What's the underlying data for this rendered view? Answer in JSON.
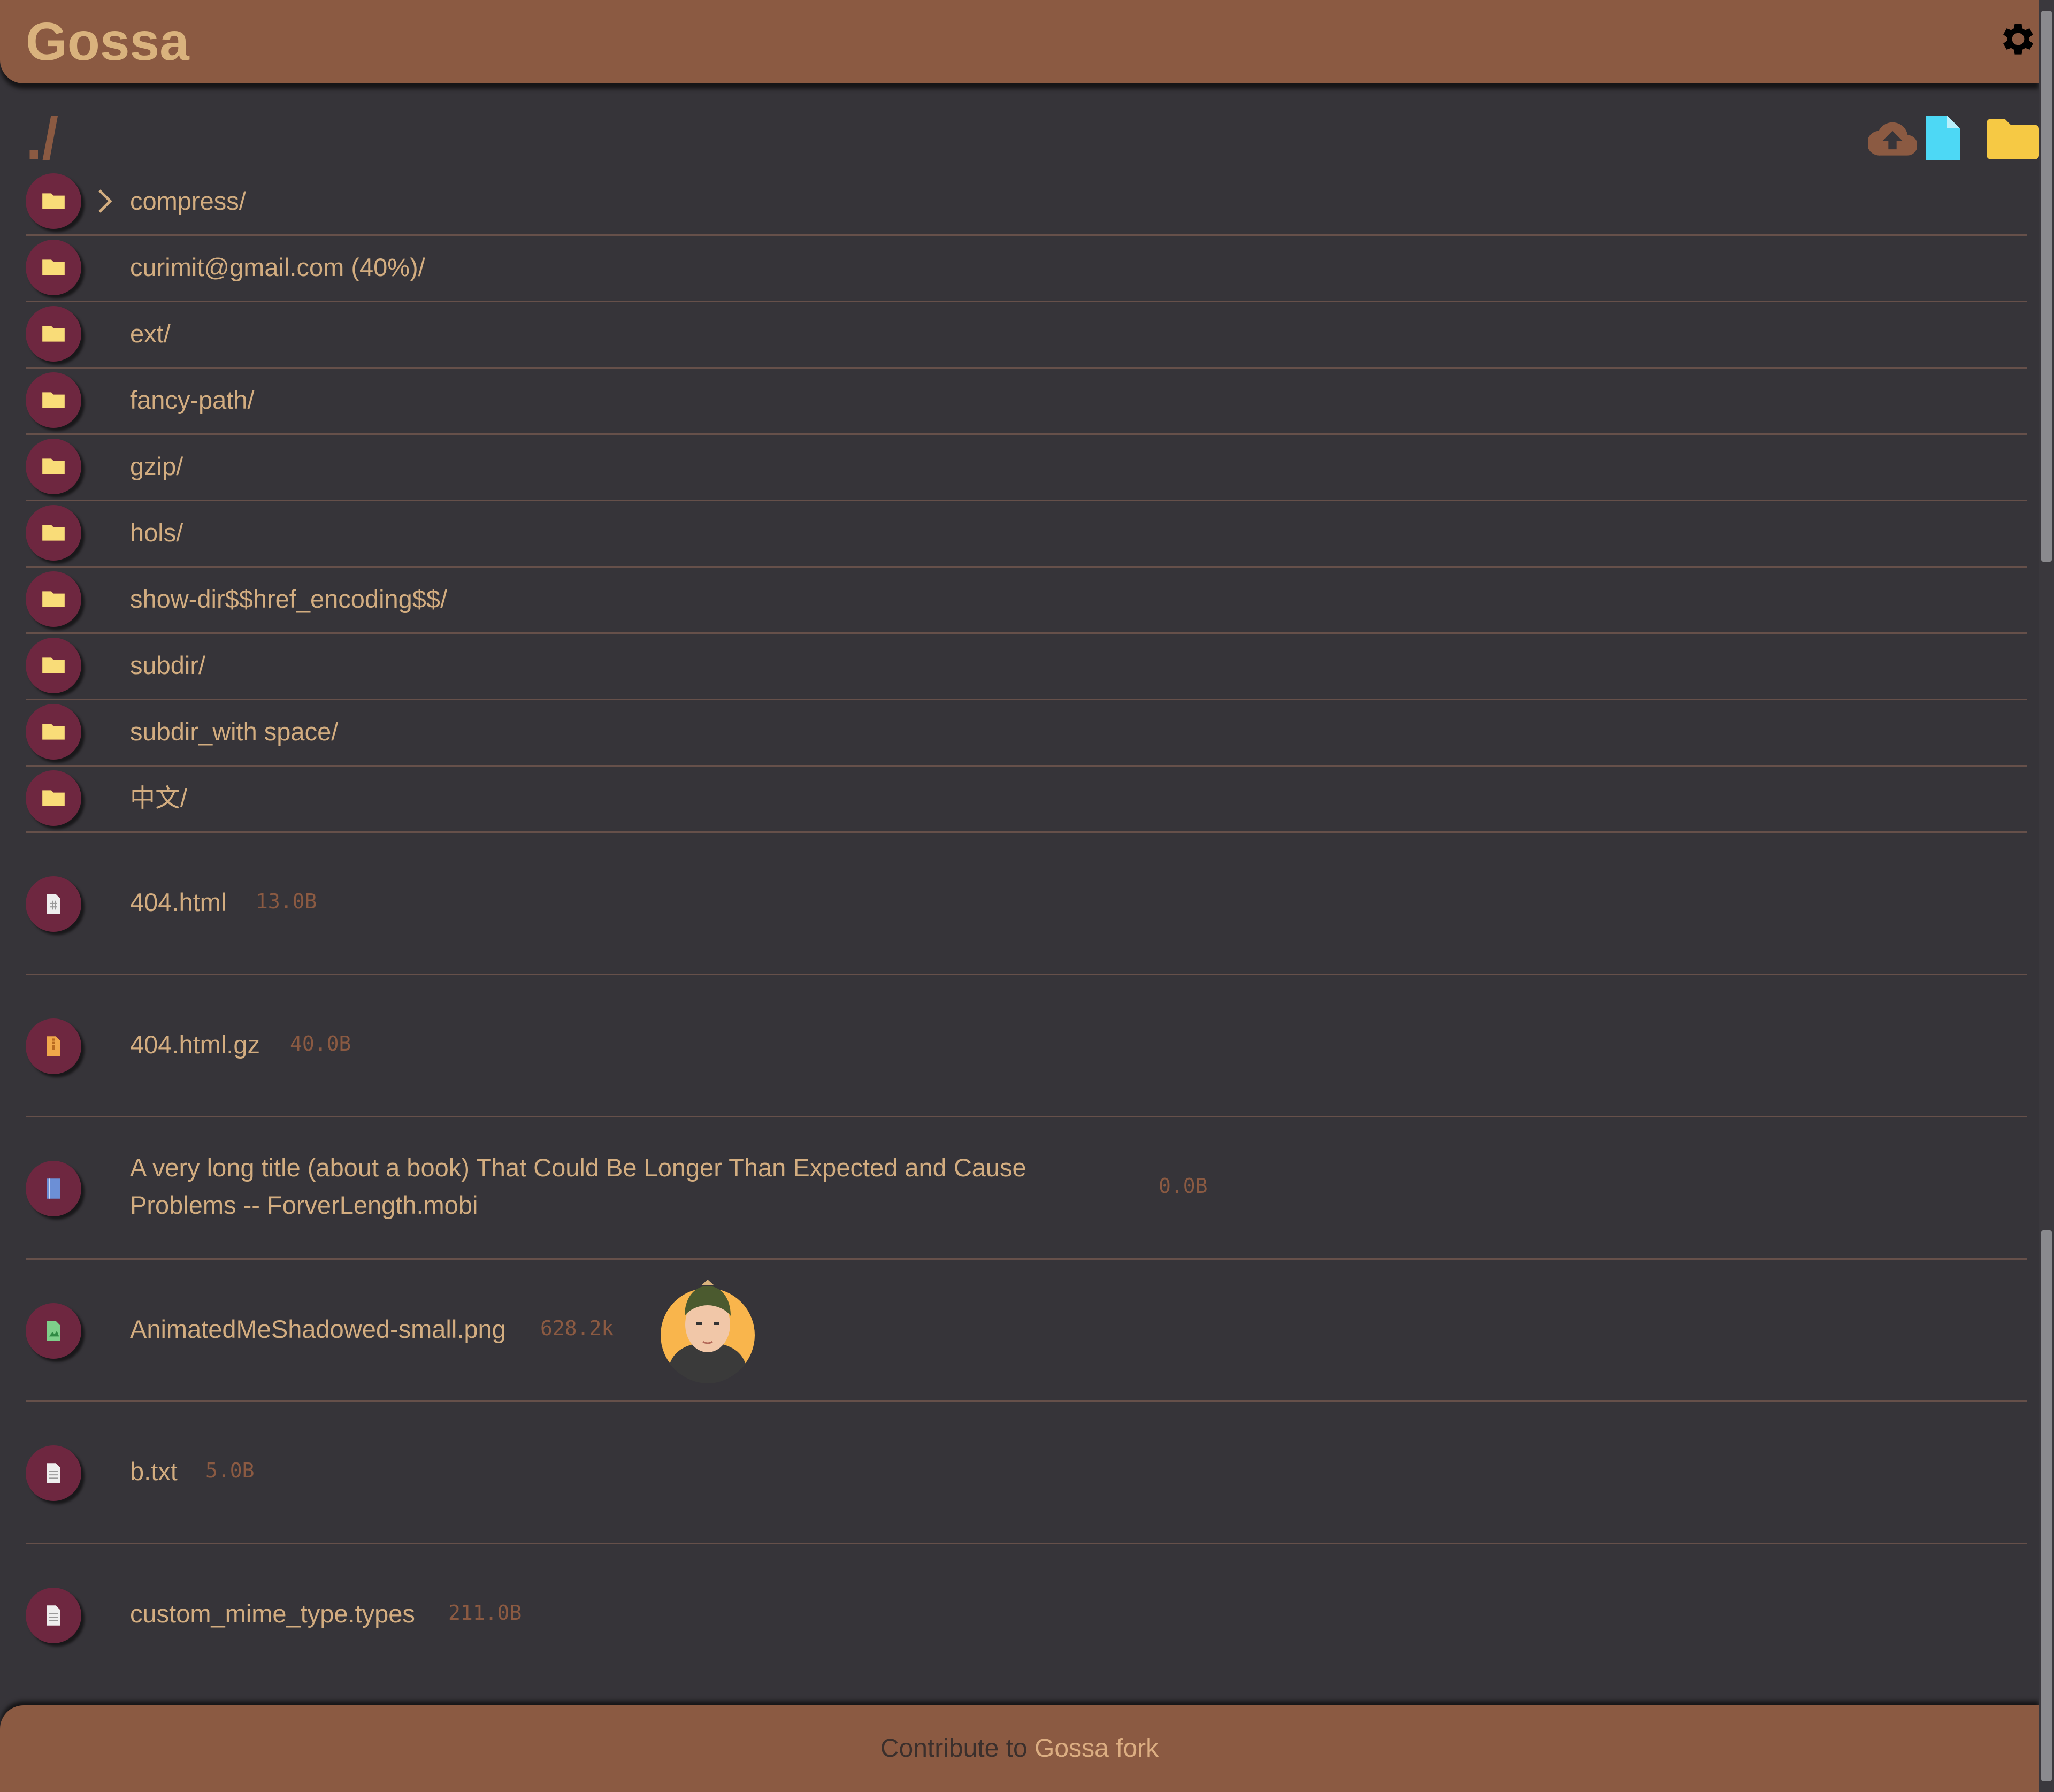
{
  "app": {
    "title": "Gossa"
  },
  "path": "./",
  "dirs": [
    {
      "name": "compress/",
      "expandable": true
    },
    {
      "name": "curimit@gmail.com (40%)/"
    },
    {
      "name": "ext/"
    },
    {
      "name": "fancy-path/"
    },
    {
      "name": "gzip/"
    },
    {
      "name": "hols/"
    },
    {
      "name": "show-dir$$href_encoding$$/"
    },
    {
      "name": "subdir/"
    },
    {
      "name": "subdir_with space/"
    },
    {
      "name": "中文/"
    }
  ],
  "files": [
    {
      "name": "404.html",
      "size": "13.0B",
      "icon": "html-file-icon"
    },
    {
      "name": "404.html.gz",
      "size": "40.0B",
      "icon": "archive-file-icon"
    },
    {
      "name": "A very long title (about a book) That Could Be Longer Than Expected and Cause",
      "name2": "Problems -- ForverLength.mobi",
      "size": "0.0B",
      "icon": "ebook-file-icon"
    },
    {
      "name": "AnimatedMeShadowed-small.png",
      "size": "628.2k",
      "icon": "image-file-icon",
      "thumbnail": "avatar-thumbnail"
    },
    {
      "name": "b.txt",
      "size": "5.0B",
      "icon": "text-file-icon"
    },
    {
      "name": "custom_mime_type.types",
      "size": "211.0B",
      "icon": "text-file-icon"
    }
  ],
  "footer": {
    "prefix": "Contribute to ",
    "link": "Gossa fork"
  },
  "colors": {
    "background": "#363439",
    "header": "#8b5a42",
    "title": "#d9b27d",
    "badge": "#6e2740",
    "text": "#d3ad80",
    "size": "#8b5a42",
    "folder": "#f9dc78",
    "newfile": "#4dd8f5",
    "newfolder": "#f6c944"
  },
  "icons": {
    "settings": "gear-icon",
    "upload": "cloud-upload-icon",
    "new_file": "new-file-icon",
    "new_folder": "new-folder-icon",
    "folder": "folder-icon",
    "expand": "chevron-right-icon"
  }
}
